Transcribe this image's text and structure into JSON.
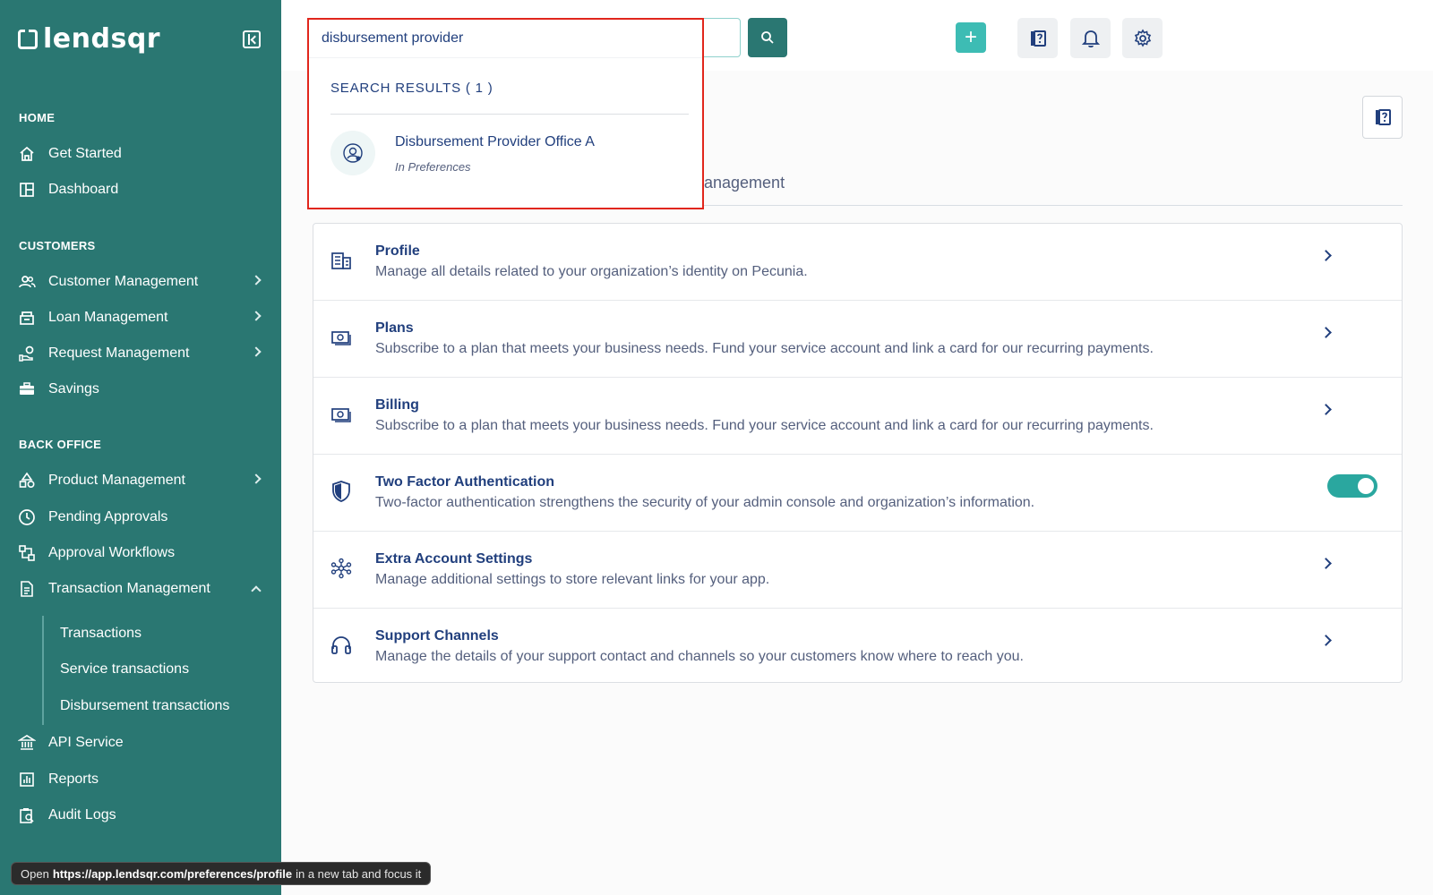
{
  "app": {
    "logo_text": "lendsqr"
  },
  "sidebar": {
    "sections": {
      "home": "HOME",
      "customers": "CUSTOMERS",
      "back_office": "BACK OFFICE"
    },
    "items": {
      "get_started": "Get Started",
      "dashboard": "Dashboard",
      "customer_management": "Customer Management",
      "loan_management": "Loan Management",
      "request_management": "Request Management",
      "savings": "Savings",
      "product_management": "Product Management",
      "pending_approvals": "Pending Approvals",
      "approval_workflows": "Approval Workflows",
      "transaction_management": "Transaction Management",
      "transactions": "Transactions",
      "service_transactions": "Service transactions",
      "disbursement_transactions": "Disbursement transactions",
      "api_service": "API Service",
      "reports": "Reports",
      "audit_logs": "Audit Logs"
    }
  },
  "search": {
    "query": "disbursement provider",
    "results_title": "SEARCH RESULTS ( 1 )",
    "results": [
      {
        "title": "Disbursement Provider Office A",
        "subtitle": "In Preferences"
      }
    ]
  },
  "topbar": {
    "add_label": "+"
  },
  "tab": {
    "label_visible": "anagement"
  },
  "settings_rows": [
    {
      "icon": "building-icon",
      "title": "Profile",
      "desc": "Manage all details related to your organization’s identity on Pecunia."
    },
    {
      "icon": "money-icon",
      "title": "Plans",
      "desc": "Subscribe to a plan that meets your business needs. Fund your service account and link a card for our recurring payments."
    },
    {
      "icon": "money-icon",
      "title": "Billing",
      "desc": "Subscribe to a plan that meets your business needs. Fund your service account and link a card for our recurring payments."
    },
    {
      "icon": "shield-icon",
      "title": "Two Factor Authentication",
      "desc": "Two-factor authentication strengthens the security of your admin console and organization’s information.",
      "toggle_on": true
    },
    {
      "icon": "network-icon",
      "title": "Extra Account Settings",
      "desc": "Manage additional settings to store relevant links for your app."
    },
    {
      "icon": "headset-icon",
      "title": "Support Channels",
      "desc": "Manage the details of your support contact and channels so your customers know where to reach you."
    }
  ],
  "statusbar": {
    "prefix": "Open",
    "url": "https://app.lendsqr.com/preferences/profile",
    "suffix": "in a new tab and focus it"
  },
  "colors": {
    "sidebar": "#2a7772",
    "accent": "#3dbcb4",
    "text_primary": "#213f7d",
    "highlight_border": "#e1261c"
  }
}
